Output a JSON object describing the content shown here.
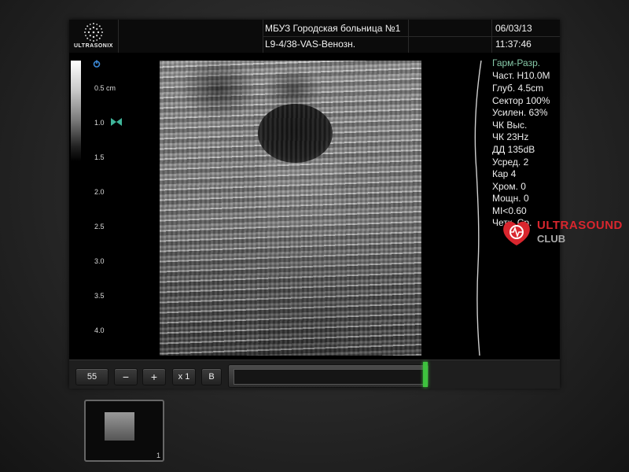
{
  "header": {
    "brand": "ULTRASONIX",
    "institution": "МБУЗ Городская больница №1",
    "preset": "L9-4/38-VAS-Венозн.",
    "date": "06/03/13",
    "time": "11:37:46"
  },
  "depth_scale": {
    "unit_label": "0.5 cm",
    "marks": [
      "1.0",
      "1.5",
      "2.0",
      "2.5",
      "3.0",
      "3.5",
      "4.0"
    ]
  },
  "parameters": [
    {
      "text": "Гарм-Разр.",
      "color": "#86c9a8"
    },
    {
      "text": "Част. H10.0M"
    },
    {
      "text": "Глуб. 4.5cm"
    },
    {
      "text": "Сектор 100%"
    },
    {
      "text": "Усилен. 63%"
    },
    {
      "text": "ЧК Выс."
    },
    {
      "text": "ЧК 23Hz"
    },
    {
      "text": "ДД 135dB"
    },
    {
      "text": "Усред. 2"
    },
    {
      "text": "Кар 4"
    },
    {
      "text": "Хром. 0"
    },
    {
      "text": "Мощн. 0"
    },
    {
      "text": "MI<0.60"
    },
    {
      "text": "Четк. Ср."
    }
  ],
  "watermark": {
    "line1": "ULTRASOUND",
    "line2": "CLUB"
  },
  "toolbar": {
    "frame_value": "55",
    "minus_label": "−",
    "plus_label": "+",
    "zoom_label": "x 1",
    "mode_label": "B",
    "cine_position": 1.0,
    "marker_color": "#3ec33e"
  },
  "thumbnails": [
    {
      "number": "1"
    }
  ],
  "icons": {
    "power": "power-icon",
    "focus": "focus-marker-icon"
  }
}
